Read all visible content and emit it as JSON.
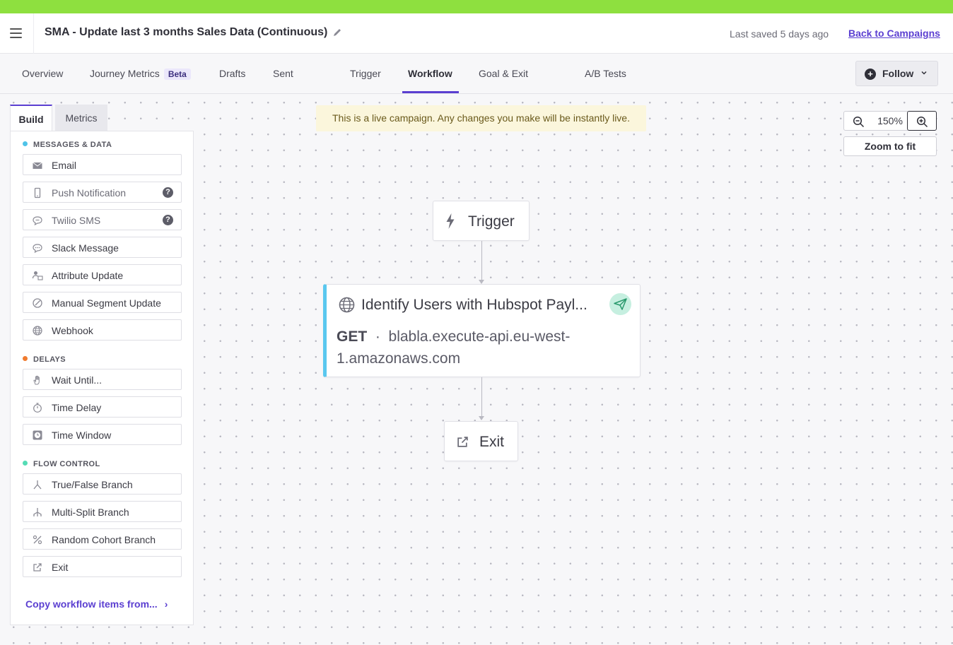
{
  "app": {
    "accent_color": "#5b3fd1",
    "top_strip_color": "#8ee03f"
  },
  "header": {
    "title": "SMA - Update last 3 months Sales Data (Continuous)",
    "last_saved": "Last saved 5 days ago",
    "back_link": "Back to Campaigns",
    "icons": [
      "hamburger-icon",
      "pencil-icon"
    ]
  },
  "tabs": {
    "items": [
      {
        "label": "Overview"
      },
      {
        "label": "Journey Metrics",
        "badge": "Beta"
      },
      {
        "label": "Drafts"
      },
      {
        "label": "Sent"
      },
      {
        "label": "Trigger"
      },
      {
        "label": "Workflow",
        "active": true
      },
      {
        "label": "Goal & Exit"
      },
      {
        "label": "A/B Tests"
      }
    ],
    "follow_label": "Follow"
  },
  "sidebar": {
    "tabs": [
      {
        "label": "Build",
        "active": true
      },
      {
        "label": "Metrics"
      }
    ],
    "sections": [
      {
        "label": "MESSAGES & DATA",
        "color": "#4fc3e8",
        "items": [
          {
            "label": "Email",
            "icon": "envelope-icon"
          },
          {
            "label": "Push Notification",
            "icon": "mobile-icon",
            "help": "?"
          },
          {
            "label": "Twilio SMS",
            "icon": "chat-bubble-icon",
            "help": "?"
          },
          {
            "label": "Slack Message",
            "icon": "chat-bubble-icon"
          },
          {
            "label": "Attribute Update",
            "icon": "user-card-icon"
          },
          {
            "label": "Manual Segment Update",
            "icon": "segment-icon"
          },
          {
            "label": "Webhook",
            "icon": "globe-icon"
          }
        ]
      },
      {
        "label": "DELAYS",
        "color": "#f07b2f",
        "items": [
          {
            "label": "Wait Until...",
            "icon": "hand-icon"
          },
          {
            "label": "Time Delay",
            "icon": "stopwatch-icon"
          },
          {
            "label": "Time Window",
            "icon": "clock-icon"
          }
        ]
      },
      {
        "label": "FLOW CONTROL",
        "color": "#55dcb5",
        "items": [
          {
            "label": "True/False Branch",
            "icon": "split-branch-icon"
          },
          {
            "label": "Multi-Split Branch",
            "icon": "multi-branch-icon"
          },
          {
            "label": "Random Cohort Branch",
            "icon": "percent-icon"
          },
          {
            "label": "Exit",
            "icon": "external-exit-icon"
          }
        ]
      }
    ],
    "copy_link": "Copy workflow items from..."
  },
  "canvas": {
    "banner": "This is a live campaign. Any changes you make will be instantly live.",
    "zoom_level": "150%",
    "zoom_to_fit": "Zoom to fit",
    "nodes": {
      "trigger": {
        "label": "Trigger",
        "icon": "lightning-icon"
      },
      "webhook": {
        "name": "Identify Users with Hubspot Payl...",
        "method": "GET",
        "separator": "·",
        "url": "blabla.execute-api.eu-west-1.amazonaws.com",
        "accent": "#5ac8ef",
        "icons": [
          "globe-icon",
          "send-icon"
        ]
      },
      "exit": {
        "label": "Exit",
        "icon": "external-exit-icon"
      }
    }
  }
}
